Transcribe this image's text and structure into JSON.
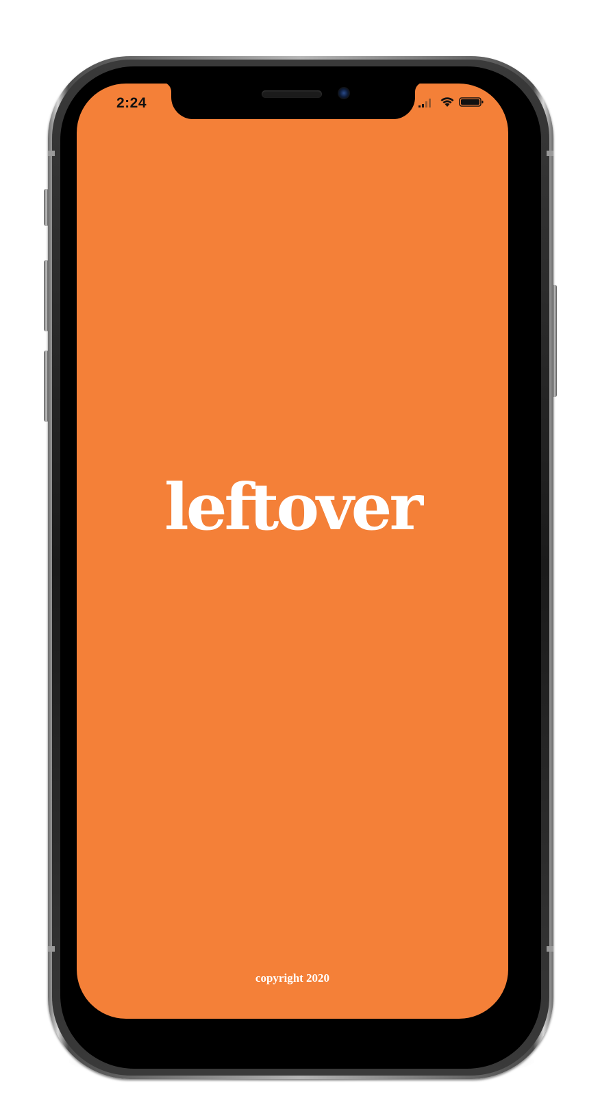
{
  "colors": {
    "splash_background": "#f48038",
    "logo_text": "#ffffff",
    "status_text": "#111111"
  },
  "status_bar": {
    "time": "2:24",
    "icons": [
      "cellular-signal-icon",
      "wifi-icon",
      "battery-icon"
    ]
  },
  "splash": {
    "logo_text": "leftover",
    "footer_text": "copyright 2020"
  }
}
